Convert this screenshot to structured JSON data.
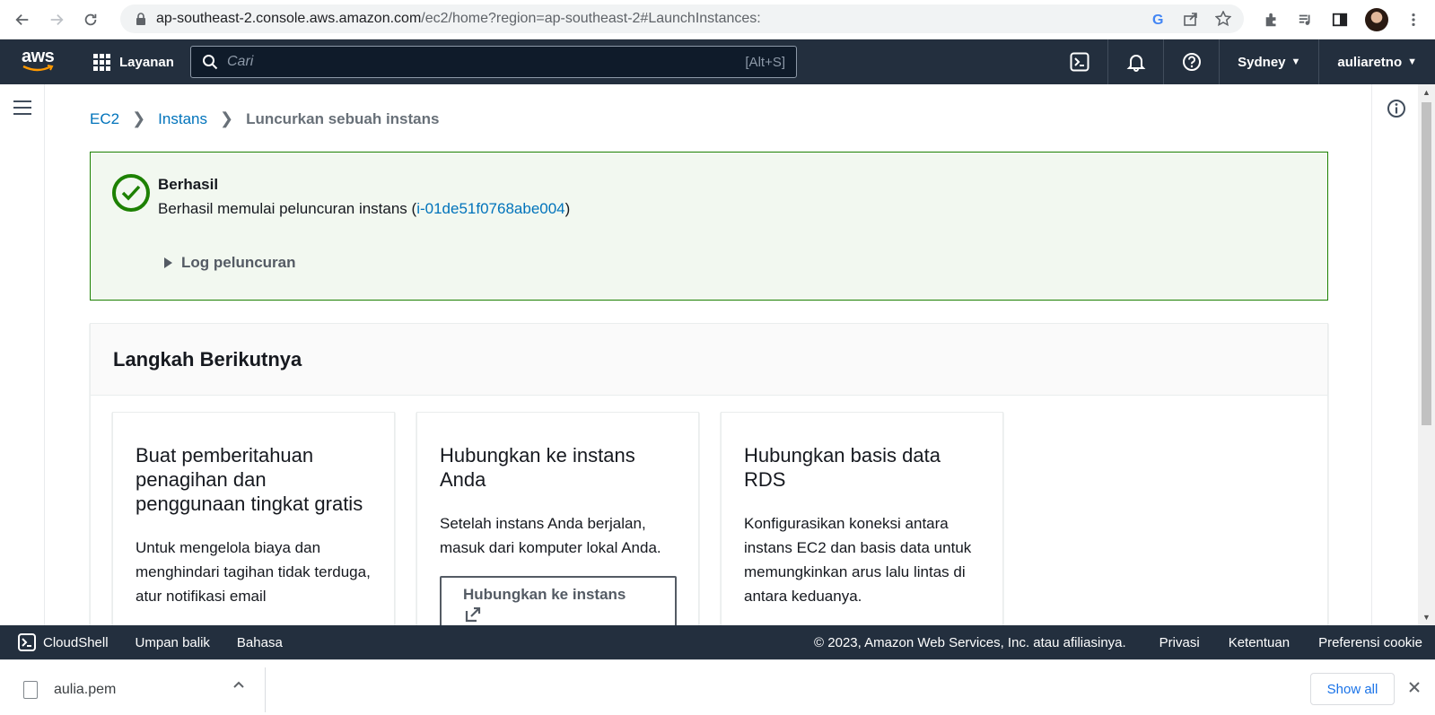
{
  "browser": {
    "url_host": "ap-southeast-2.console.aws.amazon.com",
    "url_path": "/ec2/home?region=ap-southeast-2#LaunchInstances:"
  },
  "topnav": {
    "logo": "aws",
    "services_label": "Layanan",
    "search_placeholder": "Cari",
    "search_shortcut": "[Alt+S]",
    "region": "Sydney",
    "user": "auliaretno"
  },
  "breadcrumb": {
    "items": [
      "EC2",
      "Instans"
    ],
    "current": "Luncurkan sebuah instans"
  },
  "alert": {
    "title": "Berhasil",
    "message_prefix": "Berhasil memulai peluncuran instans (",
    "instance_id": "i-01de51f0768abe004",
    "message_suffix": ")",
    "log_label": "Log peluncuran"
  },
  "next_steps": {
    "title": "Langkah Berikutnya",
    "cards": [
      {
        "title": "Buat pemberitahuan penagihan dan penggunaan tingkat gratis",
        "desc": "Untuk mengelola biaya dan menghindari tagihan tidak terduga, atur notifikasi email"
      },
      {
        "title": "Hubungkan ke instans Anda",
        "desc": "Setelah instans Anda berjalan, masuk dari komputer lokal Anda.",
        "button": "Hubungkan ke instans"
      },
      {
        "title": "Hubungkan basis data RDS",
        "desc": "Konfigurasikan koneksi antara instans EC2 dan basis data untuk memungkinkan arus lalu lintas di antara keduanya."
      }
    ]
  },
  "footer": {
    "cloudshell": "CloudShell",
    "feedback": "Umpan balik",
    "language": "Bahasa",
    "copyright": "© 2023, Amazon Web Services, Inc. atau afiliasinya.",
    "privacy": "Privasi",
    "terms": "Ketentuan",
    "cookies": "Preferensi cookie"
  },
  "downloads": {
    "file": "aulia.pem",
    "show_all": "Show all"
  },
  "colors": {
    "aws_nav": "#232f3e",
    "success": "#1d8102",
    "link": "#0073bb"
  }
}
